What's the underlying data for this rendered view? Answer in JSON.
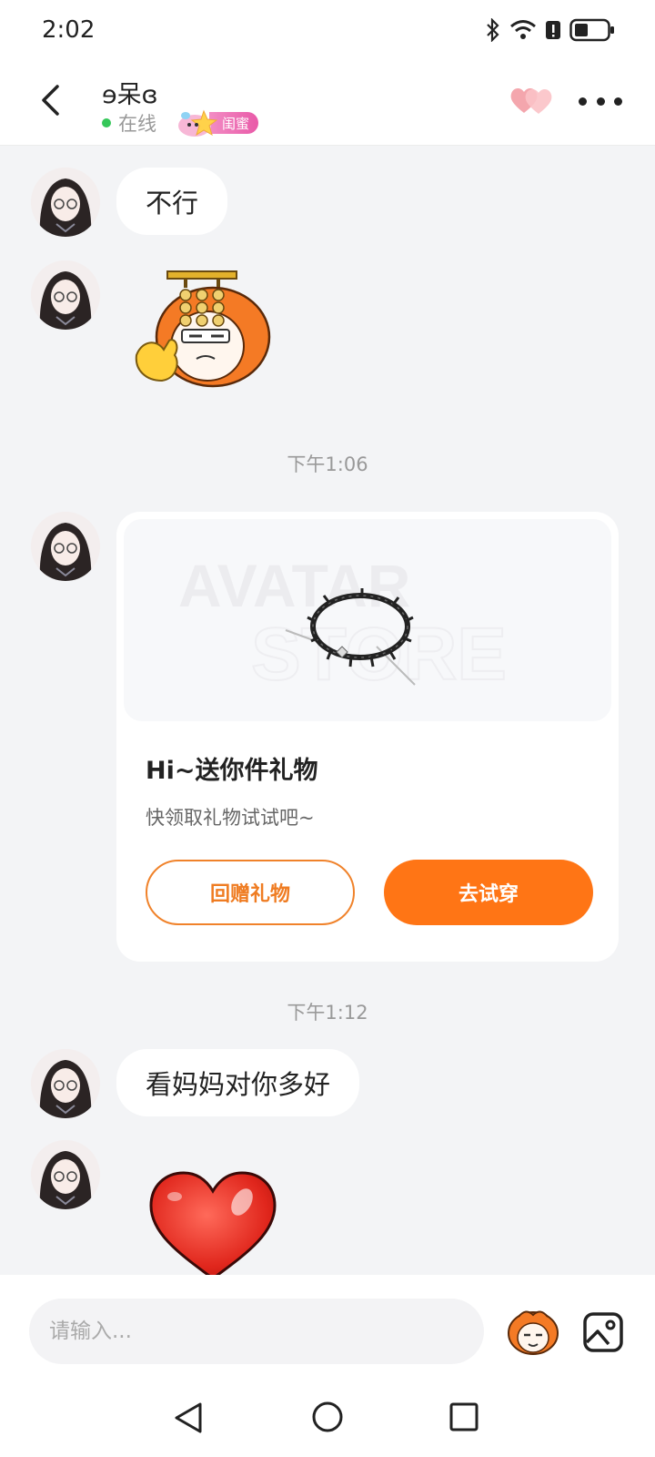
{
  "status_bar": {
    "time": "2:02"
  },
  "header": {
    "name": "ɘ呆ɞ",
    "online_status": "在线",
    "badge": "闺蜜"
  },
  "messages": {
    "msg1": "不行",
    "time1": "下午1:06",
    "gift": {
      "image_text_line1": "AVATAR",
      "image_text_line2": "STORE",
      "title": "Hi~送你件礼物",
      "subtitle": "快领取礼物试试吧~",
      "return_button": "回赠礼物",
      "try_button": "去试穿"
    },
    "time2": "下午1:12",
    "msg2": "看妈妈对你多好"
  },
  "input": {
    "placeholder": "请输入..."
  },
  "icons": {
    "back": "chevron-left-icon",
    "hearts": "hearts-icon",
    "more": "more-dots-icon",
    "emoji": "emoji-mascot-icon",
    "image": "image-icon"
  },
  "colors": {
    "accent": "#ff7515",
    "online": "#35c759",
    "badge": "#e95aa8"
  }
}
